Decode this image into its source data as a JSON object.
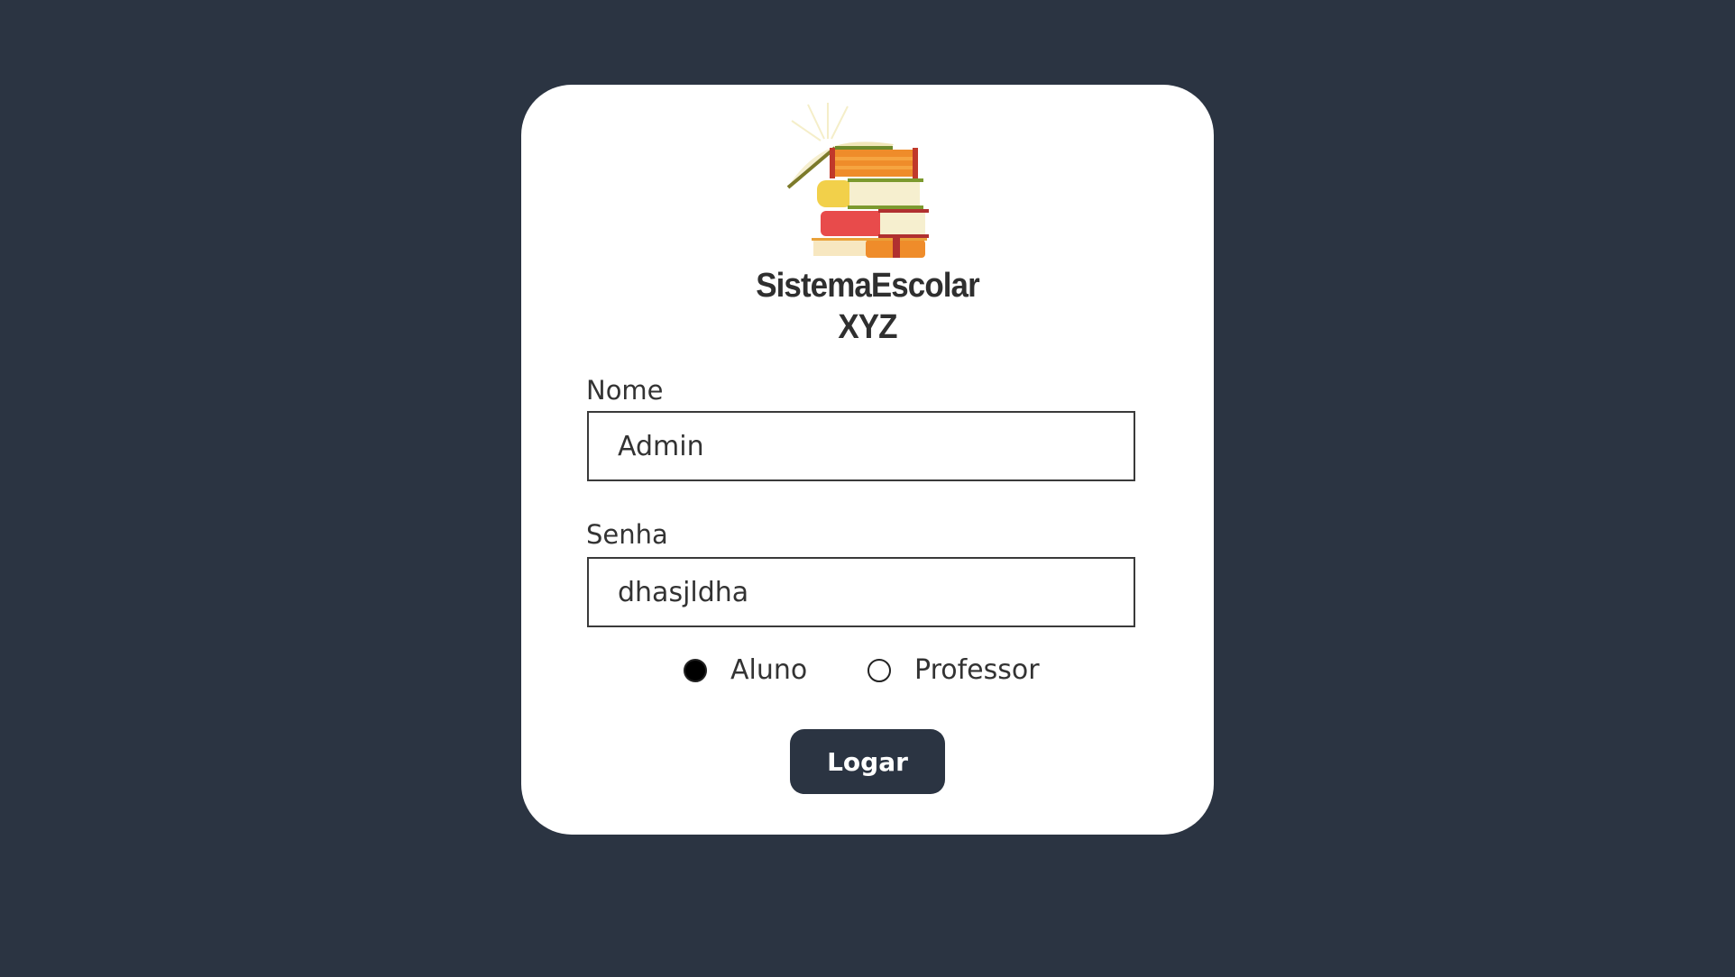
{
  "app": {
    "title_line1": "SistemaEscolar",
    "title_line2": "XYZ",
    "logo_icon": "books-stack-icon"
  },
  "form": {
    "nome_label": "Nome",
    "nome_value": "Admin",
    "senha_label": "Senha",
    "senha_value": "dhasjldha",
    "role_options": [
      {
        "label": "Aluno",
        "selected": true
      },
      {
        "label": "Professor",
        "selected": false
      }
    ],
    "submit_label": "Logar"
  },
  "colors": {
    "background": "#2b3442",
    "card": "#ffffff",
    "button": "#2b3442",
    "button_text": "#ffffff"
  }
}
